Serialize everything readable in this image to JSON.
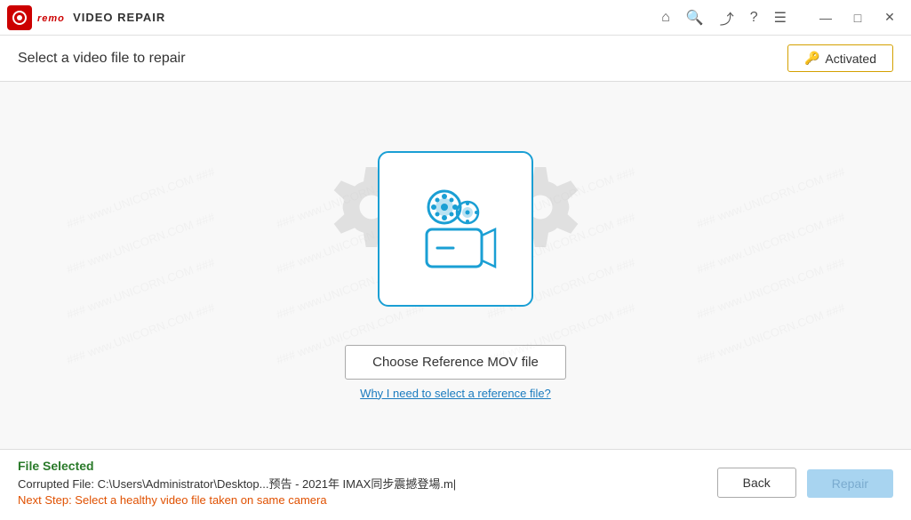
{
  "app": {
    "logo_text": "remo",
    "title": "VIDEO REPAIR"
  },
  "titlebar": {
    "icons": [
      "home",
      "search",
      "share",
      "help",
      "menu"
    ],
    "window_controls": [
      "minimize",
      "maximize",
      "close"
    ]
  },
  "header": {
    "subtitle": "Select a video file to repair",
    "activated_label": "Activated"
  },
  "main": {
    "choose_ref_btn_label": "Choose Reference MOV file",
    "why_link_label": "Why I need to select a reference file?"
  },
  "footer": {
    "file_selected_label": "File Selected",
    "corrupted_file_text": "Corrupted File: C:\\Users\\Administrator\\Desktop...预告 - 2021年 IMAX同步震撼登場.m|",
    "next_step_text": "Next Step: Select a healthy video file taken on same camera",
    "back_btn_label": "Back",
    "repair_btn_label": "Repair"
  },
  "watermark": {
    "rows": [
      [
        "###  www.UNICORN.COM  ###",
        "###  www.UNICORN.COM  ###",
        "###  www.UNICORN.COM  ###"
      ],
      [
        "###  www.UNICORN.COM  ###",
        "###  www.UNICORN.COM  ###",
        "###  www.UNICORN.COM  ###"
      ],
      [
        "###  www.UNICORN.COM  ###",
        "###  www.UNICORN.COM  ###",
        "###  www.UNICORN.COM  ###"
      ]
    ]
  }
}
